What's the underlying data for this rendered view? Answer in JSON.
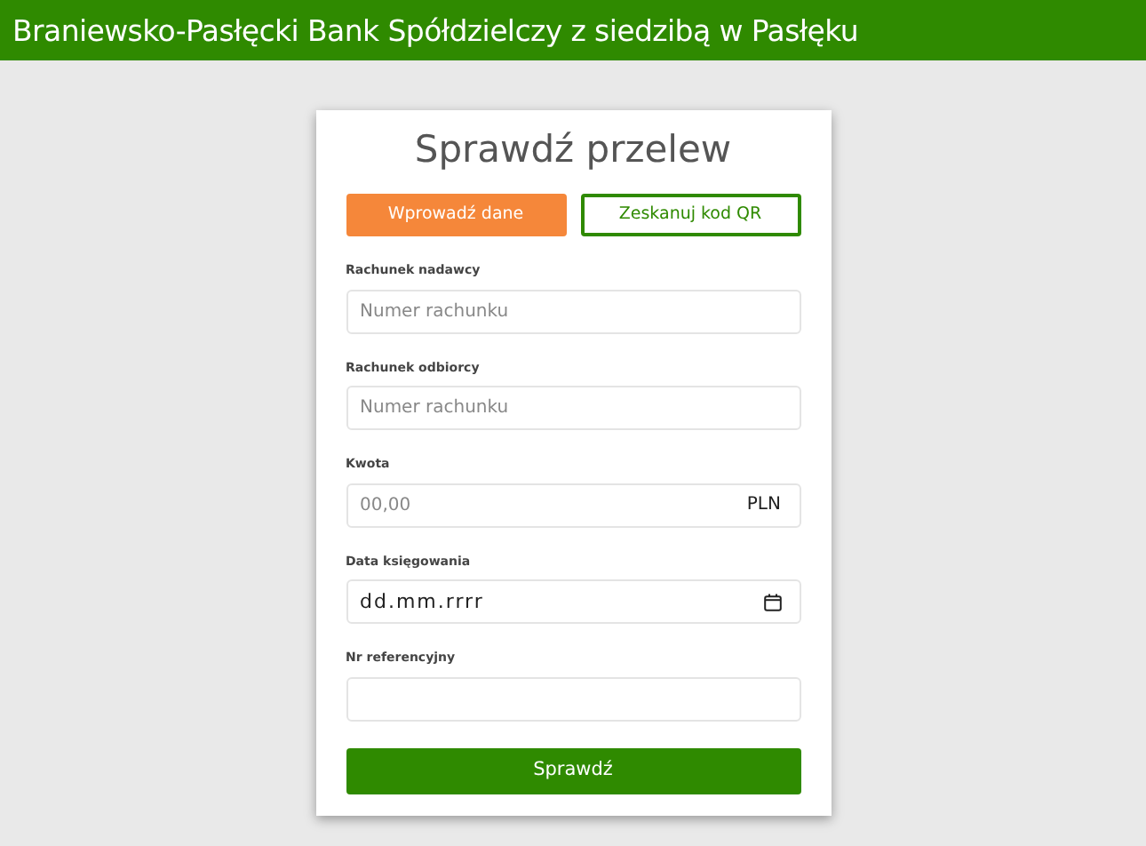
{
  "header": {
    "title": "Braniewsko-Pasłęcki Bank Spółdzielczy z siedzibą w Pasłęku"
  },
  "form": {
    "title": "Sprawdź przelew",
    "tabs": [
      {
        "label": "Wprowadź dane",
        "selected": true
      },
      {
        "label": "Zeskanuj kod QR",
        "selected": false
      }
    ],
    "fields": [
      {
        "kind": "text",
        "label": "Rachunek nadawcy",
        "placeholder": "Numer rachunku"
      },
      {
        "kind": "text",
        "label": "Rachunek odbiorcy",
        "placeholder": "Numer rachunku"
      },
      {
        "kind": "amount",
        "label": "Kwota",
        "placeholder": "00,00",
        "suffix": "PLN"
      },
      {
        "kind": "date",
        "label": "Data księgowania",
        "value": "dd.mm.rrrr"
      },
      {
        "kind": "text",
        "label": "Nr referencyjny"
      }
    ],
    "submit": "Sprawdź"
  }
}
